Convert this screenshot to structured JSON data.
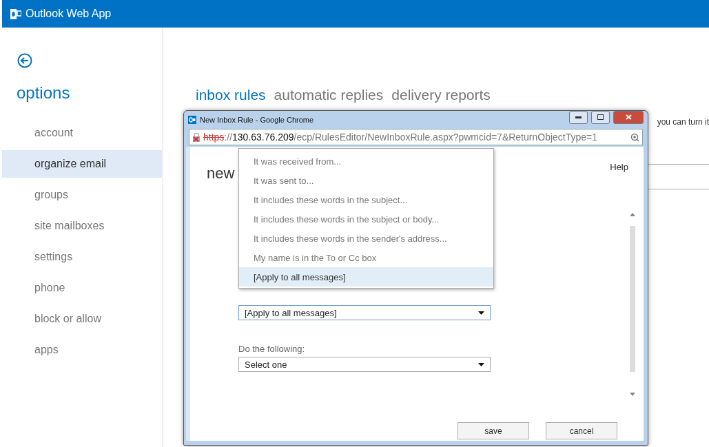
{
  "app": {
    "title": "Outlook Web App"
  },
  "sidebar": {
    "title": "options",
    "items": [
      {
        "label": "account",
        "selected": false
      },
      {
        "label": "organize email",
        "selected": true
      },
      {
        "label": "groups",
        "selected": false
      },
      {
        "label": "site mailboxes",
        "selected": false
      },
      {
        "label": "settings",
        "selected": false
      },
      {
        "label": "phone",
        "selected": false
      },
      {
        "label": "block or allow",
        "selected": false
      },
      {
        "label": "apps",
        "selected": false
      }
    ]
  },
  "tabs": [
    {
      "label": "inbox rules",
      "selected": true
    },
    {
      "label": "automatic replies",
      "selected": false
    },
    {
      "label": "delivery reports",
      "selected": false
    }
  ],
  "background_text": "you can turn it",
  "popup": {
    "title": "New Inbox Rule - Google Chrome",
    "url": {
      "scheme": "https",
      "separator": "://",
      "host": "130.63.76.209",
      "path": "/ecp/RulesEditor/NewInboxRule.aspx?pwmcid=7&ReturnObjectType=1"
    },
    "heading": "new",
    "help": "Help",
    "condition_options": [
      {
        "label": "It was received from...",
        "selected": false
      },
      {
        "label": "It was sent to...",
        "selected": false
      },
      {
        "label": "It includes these words in the subject...",
        "selected": false
      },
      {
        "label": "It includes these words in the subject or body...",
        "selected": false
      },
      {
        "label": "It includes these words in the sender's address...",
        "selected": false
      },
      {
        "label": "My name is in the To or Cc box",
        "selected": false
      },
      {
        "label": "[Apply to all messages]",
        "selected": true
      }
    ],
    "condition_value": "[Apply to all messages]",
    "action_label": "Do the following:",
    "action_value": "Select one",
    "buttons": [
      "save",
      "cancel"
    ]
  }
}
